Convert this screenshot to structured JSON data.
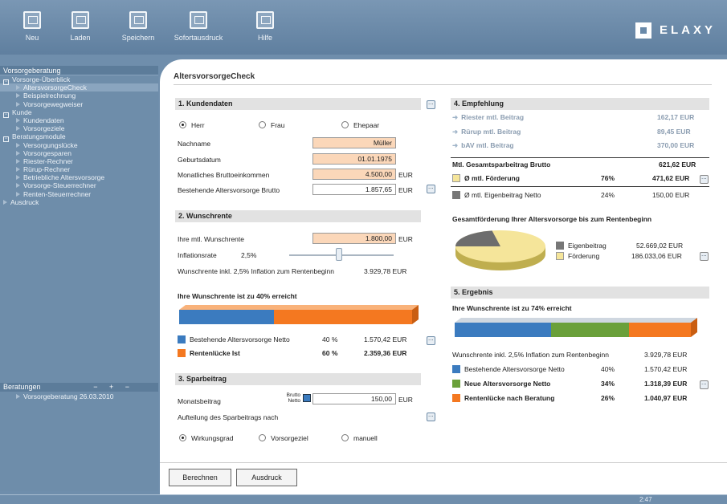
{
  "toolbar": {
    "neu": "Neu",
    "laden": "Laden",
    "speichern": "Speichern",
    "sofortausdruck": "Sofortausdruck",
    "hilfe": "Hilfe"
  },
  "logo": "ELAXY",
  "sidebar": {
    "header": "Vorsorgeberatung",
    "items": [
      {
        "label": "Vorsorge-Überblick",
        "level": 1,
        "box": "−"
      },
      {
        "label": "AltersvorsorgeCheck",
        "level": 2,
        "selected": true
      },
      {
        "label": "Beispielrechnung",
        "level": 2
      },
      {
        "label": "Vorsorgewegweiser",
        "level": 2
      },
      {
        "label": "Kunde",
        "level": 1,
        "box": "−"
      },
      {
        "label": "Kundendaten",
        "level": 2
      },
      {
        "label": "Vorsorgeziele",
        "level": 2
      },
      {
        "label": "Beratungsmodule",
        "level": 1,
        "box": "−"
      },
      {
        "label": "Versorgungslücke",
        "level": 2
      },
      {
        "label": "Vorsorgesparen",
        "level": 2
      },
      {
        "label": "Riester-Rechner",
        "level": 2
      },
      {
        "label": "Rürup-Rechner",
        "level": 2
      },
      {
        "label": "Betriebliche Altersvorsorge",
        "level": 2
      },
      {
        "label": "Vorsorge-Steuerrechner",
        "level": 2
      },
      {
        "label": "Renten-Steuerrechner",
        "level": 2
      },
      {
        "label": "Ausdruck",
        "level": 1
      }
    ],
    "beratungen_label": "Beratungen",
    "beratungen_ctrl": "− + −",
    "beratung_item": "Vorsorgeberatung 26.03.2010"
  },
  "page_title": "AltersvorsorgeCheck",
  "kunden": {
    "title": "1. Kundendaten",
    "radio_herr": "Herr",
    "radio_frau": "Frau",
    "radio_ehepaar": "Ehepaar",
    "nachname_label": "Nachname",
    "nachname": "Müller",
    "geburtsdatum_label": "Geburtsdatum",
    "geburtsdatum": "01.01.1975",
    "einkommen_label": "Monatliches Bruttoeinkommen",
    "einkommen": "4.500,00",
    "altersvorsorge_label": "Bestehende Altersvorsorge Brutto",
    "altersvorsorge": "1.857,65",
    "eur": "EUR"
  },
  "wunsch": {
    "title": "2. Wunschrente",
    "rente_label": "Ihre mtl. Wunschrente",
    "rente": "1.800,00",
    "inflation_label": "Inflationsrate",
    "inflation": "2,5%",
    "inkl_label": "Wunschrente inkl. 2,5% Inflation zum Rentenbeginn",
    "inkl": "3.929,78 EUR",
    "erreicht": "Ihre Wunschrente ist zu 40% erreicht",
    "bar_pct": 40,
    "row1": {
      "label": "Bestehende Altersvorsorge Netto",
      "pct": "40 %",
      "val": "1.570,42 EUR"
    },
    "row2": {
      "label": "Rentenlücke Ist",
      "pct": "60 %",
      "val": "2.359,36 EUR"
    }
  },
  "spar": {
    "title": "3. Sparbeitrag",
    "monatsbeitrag_label": "Monatsbeitrag",
    "brutto_netto": "Brutto Netto",
    "monatsbeitrag": "150,00",
    "aufteilung_label": "Aufteilung des Sparbeitrags nach",
    "r1": "Wirkungsgrad",
    "r2": "Vorsorgeziel",
    "r3": "manuell"
  },
  "empf": {
    "title": "4. Empfehlung",
    "rows": [
      {
        "label": "Riester mtl. Beitrag",
        "val": "162,17 EUR"
      },
      {
        "label": "Rürup mtl. Beitrag",
        "val": "89,45 EUR"
      },
      {
        "label": "bAV mtl. Beitrag",
        "val": "370,00 EUR"
      }
    ],
    "gesamt_label": "Mtl. Gesamtsparbeitrag Brutto",
    "gesamt": "621,62 EUR",
    "foerderung_label": "Ø mtl. Förderung",
    "foerderung_pct": "76%",
    "foerderung": "471,62 EUR",
    "eigen_label": "Ø mtl. Eigenbeitrag Netto",
    "eigen_pct": "24%",
    "eigen": "150,00 EUR",
    "gesamtfoerd_title": "Gesamtförderung Ihrer Altersvorsorge bis zum Rentenbeginn",
    "pie_legend": [
      {
        "label": "Eigenbeitrag",
        "val": "52.669,02 EUR"
      },
      {
        "label": "Förderung",
        "val": "186.033,06 EUR"
      }
    ],
    "pie_eigen_pct": 22
  },
  "ergebnis": {
    "title": "5. Ergebnis",
    "erreicht": "Ihre Wunschrente ist zu 74% erreicht",
    "inkl_label": "Wunschrente inkl. 2,5% Inflation zum Rentenbeginn",
    "inkl": "3.929,78 EUR",
    "rows": [
      {
        "label": "Bestehende Altersvorsorge Netto",
        "pct": "40%",
        "val": "1.570,42 EUR"
      },
      {
        "label": "Neue Altersvorsorge Netto",
        "pct": "34%",
        "val": "1.318,39 EUR"
      },
      {
        "label": "Rentenlücke nach Beratung",
        "pct": "26%",
        "val": "1.040,97 EUR"
      }
    ]
  },
  "buttons": {
    "berechnen": "Berechnen",
    "ausdruck": "Ausdruck"
  },
  "status_time": "2:47",
  "colors": {
    "blue": "#3b7bbf",
    "orange": "#f47820",
    "green": "#6aa03a",
    "field": "#fbd7b9",
    "yellow": "#f5e59a"
  }
}
